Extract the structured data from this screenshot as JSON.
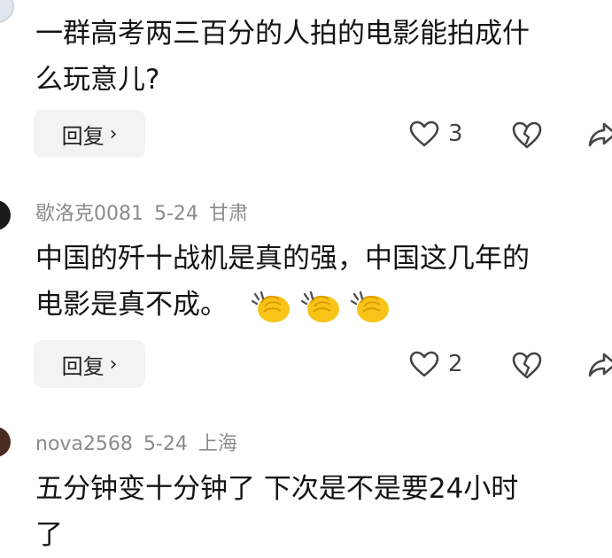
{
  "comments": [
    {
      "author": "",
      "date": "",
      "location": "",
      "text_lines": [
        "一群高考两三百分的人拍的电影能拍成什",
        "么玩意儿?"
      ],
      "reply_label": "回复",
      "like_count": "3",
      "emoji_count": 0
    },
    {
      "author": "歇洛克0081",
      "date": "5-24",
      "location": "甘肃",
      "text_lines": [
        "中国的歼十战机是真的强，中国这几年的",
        "电影是真不成。"
      ],
      "reply_label": "回复",
      "like_count": "2",
      "emoji_count": 3
    },
    {
      "author": "nova2568",
      "date": "5-24",
      "location": "上海",
      "text_lines": [
        "五分钟变十分钟了 下次是不是要24小时",
        "了"
      ],
      "reply_label": "",
      "like_count": "",
      "emoji_count": 0
    }
  ],
  "icons": {
    "like": "heart-outline-icon",
    "dislike": "broken-heart-icon",
    "share": "share-arrow-icon",
    "reaction": "clapping-hands-emoji"
  }
}
